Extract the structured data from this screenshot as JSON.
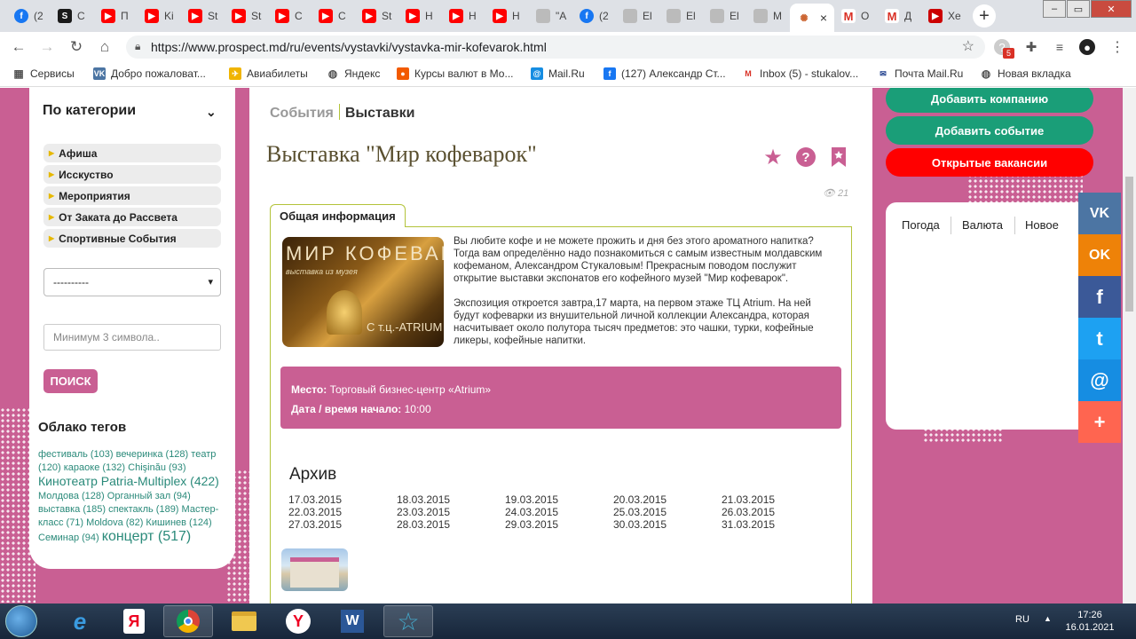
{
  "browser": {
    "tabs": [
      {
        "label": "(2",
        "icon": "fb"
      },
      {
        "label": "C",
        "icon": "sp"
      },
      {
        "label": "П",
        "icon": "yt"
      },
      {
        "label": "Ki",
        "icon": "yt"
      },
      {
        "label": "St",
        "icon": "yt"
      },
      {
        "label": "St",
        "icon": "yt"
      },
      {
        "label": "C",
        "icon": "yt"
      },
      {
        "label": "C",
        "icon": "yt"
      },
      {
        "label": "St",
        "icon": "yt"
      },
      {
        "label": "H",
        "icon": "yt"
      },
      {
        "label": "H",
        "icon": "yt"
      },
      {
        "label": "H",
        "icon": "yt"
      },
      {
        "label": "\"A",
        "icon": "gray"
      },
      {
        "label": "(2",
        "icon": "fb"
      },
      {
        "label": "El",
        "icon": "gray"
      },
      {
        "label": "El",
        "icon": "gray"
      },
      {
        "label": "El",
        "icon": "gray"
      },
      {
        "label": "M",
        "icon": "gray"
      },
      {
        "label": "",
        "icon": "pr",
        "active": true
      },
      {
        "label": "O",
        "icon": "gm"
      },
      {
        "label": "Д",
        "icon": "gm"
      },
      {
        "label": "Xe",
        "icon": "ytd"
      }
    ],
    "close_glyph": "×",
    "new_tab": "+",
    "url": "https://www.prospect.md/ru/events/vystavki/vystavka-mir-kofevarok.html",
    "ext_badge": "5",
    "bookmarks": [
      {
        "label": "Сервисы",
        "icon": "grid"
      },
      {
        "label": "Добро пожаловат...",
        "icon": "vk"
      },
      {
        "label": "Авиабилеты",
        "icon": "plane"
      },
      {
        "label": "Яндекс",
        "icon": "globe"
      },
      {
        "label": "Курсы валют в Мо...",
        "icon": "dot"
      },
      {
        "label": "Mail.Ru",
        "icon": "at"
      },
      {
        "label": "(127) Александр Ст...",
        "icon": "fb"
      },
      {
        "label": "Inbox (5) - stukalov...",
        "icon": "gm"
      },
      {
        "label": "Почта Mail.Ru",
        "icon": "mail"
      },
      {
        "label": "Новая вкладка",
        "icon": "globe"
      }
    ]
  },
  "sidebar": {
    "title": "По категории",
    "categories": [
      "Афиша",
      "Исскуство",
      "Мероприятия",
      "От Заката до Рассвета",
      "Спортивные События"
    ],
    "select_value": "----------",
    "search_placeholder": "Минимум 3 символа..",
    "search_button": "ПОИСК",
    "tags_title": "Облако тегов",
    "tags": [
      {
        "text": "фестиваль (103)",
        "size": "s"
      },
      {
        "text": "вечеринка (128)",
        "size": "s"
      },
      {
        "text": "театр (120)",
        "size": "s"
      },
      {
        "text": "караоке (132)",
        "size": "s"
      },
      {
        "text": "Chişinău (93)",
        "size": "s"
      },
      {
        "text": "Кинотеатр Patria-Multiplex (422)",
        "size": "b"
      },
      {
        "text": "Молдова (128)",
        "size": "s"
      },
      {
        "text": "Органный зал (94)",
        "size": "s"
      },
      {
        "text": "выставка (185)",
        "size": "s"
      },
      {
        "text": "спектакль (189)",
        "size": "s"
      },
      {
        "text": "Мастер-класс (71)",
        "size": "s"
      },
      {
        "text": "Moldova (82)",
        "size": "s"
      },
      {
        "text": "Кишинев (124)",
        "size": "s"
      },
      {
        "text": "Семинар (94)",
        "size": "s"
      },
      {
        "text": "концерт (517)",
        "size": "h"
      }
    ]
  },
  "main": {
    "breadcrumb": {
      "parent": "События",
      "current": "Выставки"
    },
    "title": "Выставка \"Мир кофеварок\"",
    "views": "21",
    "tab_label": "Общая информация",
    "image_text": {
      "line1": "МИР КОФЕВАР",
      "line2": "выставка из музея",
      "line3": "С т.ц.-ATRIUM"
    },
    "description": [
      "Вы любите кофе и не можете прожить и дня без этого ароматного напитка? Тогда вам определённо надо познакомиться с самым известным молдавским кофеманом, Александром Стукаловым! Прекрасным поводом послужит открытие выставки экспонатов его кофейного музей \"Мир кофеварок\".",
      "Экспозиция откроется завтра,17 марта, на первом этаже ТЦ Atrium. На ней будут кофеварки из внушительной личной коллекции Александра, которая насчитывает около полутора тысяч предметов: это чашки, турки, кофейные ликеры, кофейные напитки."
    ],
    "place_label": "Место:",
    "place_value": "Торговый бизнес-центр «Atrium»",
    "date_label": "Дата / время начало:",
    "date_value": "10:00",
    "archive_title": "Архив",
    "archive_dates": [
      [
        "17.03.2015",
        "18.03.2015",
        "19.03.2015",
        "20.03.2015",
        "21.03.2015"
      ],
      [
        "22.03.2015",
        "23.03.2015",
        "24.03.2015",
        "25.03.2015",
        "26.03.2015"
      ],
      [
        "27.03.2015",
        "28.03.2015",
        "29.03.2015",
        "30.03.2015",
        "31.03.2015"
      ]
    ]
  },
  "right": {
    "btn_company": "Добавить компанию",
    "btn_event": "Добавить событие",
    "btn_jobs": "Открытые вакансии",
    "widget_tabs": [
      "Погода",
      "Валюта",
      "Новое"
    ],
    "colors": {
      "green": "#1a9e78",
      "red": "#ff0000",
      "pink": "#c95f93"
    }
  },
  "social": [
    {
      "name": "vk",
      "glyph": "VK",
      "color": "#4c75a3"
    },
    {
      "name": "ok",
      "glyph": "OK",
      "color": "#ee8208"
    },
    {
      "name": "facebook",
      "glyph": "f",
      "color": "#3b5998"
    },
    {
      "name": "twitter",
      "glyph": "t",
      "color": "#1da1f2"
    },
    {
      "name": "mailru",
      "glyph": "@",
      "color": "#168de2"
    },
    {
      "name": "more",
      "glyph": "+",
      "color": "#ff6550"
    }
  ],
  "taskbar": {
    "lang": "RU",
    "time": "17:26",
    "date": "16.01.2021"
  }
}
